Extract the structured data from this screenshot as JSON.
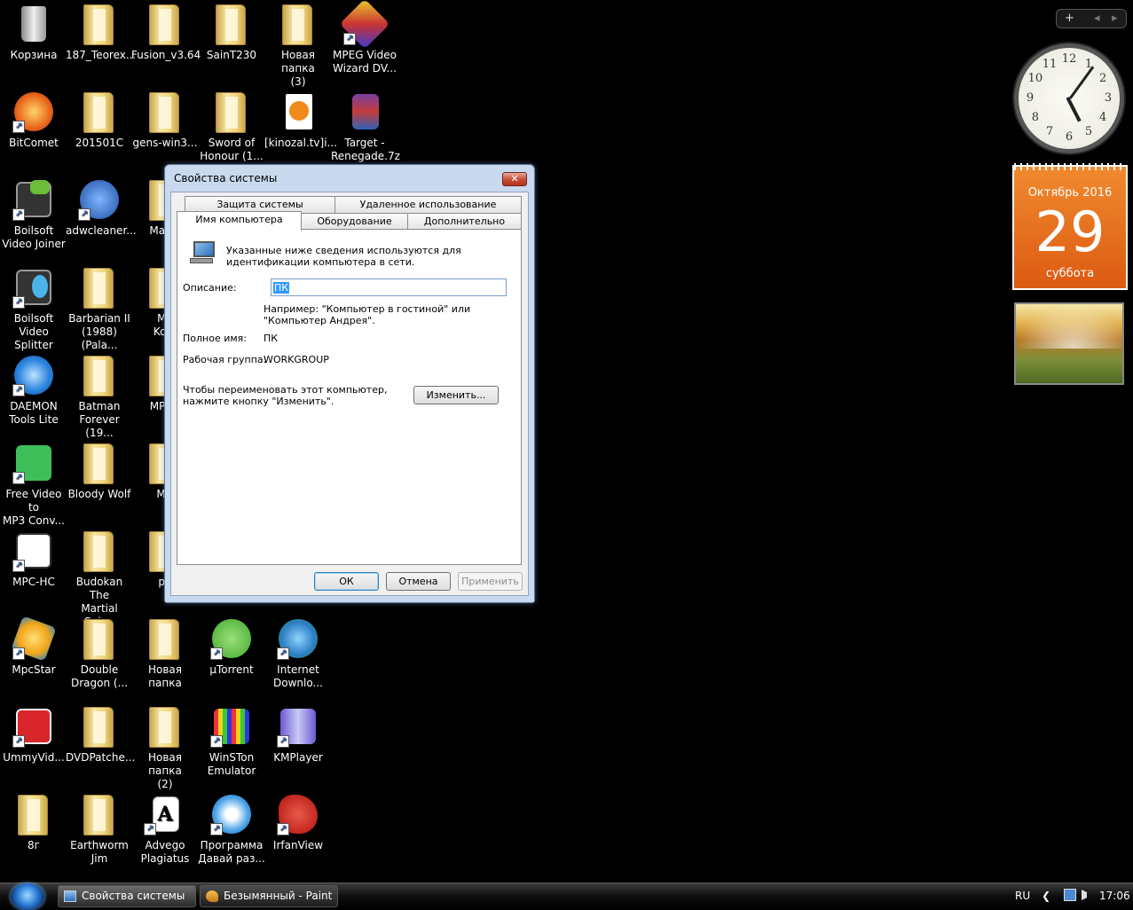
{
  "desktop_icons": [
    {
      "label": "Корзина",
      "icon": "recycle-bin-icon"
    },
    {
      "label": "187_Teorex...",
      "icon": "folder-icon"
    },
    {
      "label": "Fusion_v3.64",
      "icon": "folder-icon"
    },
    {
      "label": "SainT230",
      "icon": "folder-icon"
    },
    {
      "label": "Новая папка\n(3)",
      "icon": "folder-icon"
    },
    {
      "label": "MPEG Video\nWizard DV...",
      "icon": "mpeg-wizard-icon"
    },
    {
      "label": "BitComet",
      "icon": "bitcomet-icon"
    },
    {
      "label": "201501C",
      "icon": "folder-icon"
    },
    {
      "label": "gens-win3...",
      "icon": "folder-icon"
    },
    {
      "label": "Sword of\nHonour (1...",
      "icon": "folder-icon"
    },
    {
      "label": "[kinozal.tv]i...",
      "icon": "torrent-file-icon"
    },
    {
      "label": "Target -\nRenegade.7z",
      "icon": "archive-icon"
    },
    {
      "label": "Boilsoft\nVideo Joiner",
      "icon": "video-joiner-icon"
    },
    {
      "label": "adwcleaner...",
      "icon": "adwcleaner-icon"
    },
    {
      "label": "Magic",
      "icon": "folder-icon"
    },
    {
      "label": "Boilsoft\nVideo Splitter",
      "icon": "video-splitter-icon"
    },
    {
      "label": "Barbarian II\n(1988)(Pala...",
      "icon": "folder-icon"
    },
    {
      "label": "Mo\nKom",
      "icon": "folder-icon"
    },
    {
      "label": "DAEMON\nTools Lite",
      "icon": "daemon-tools-icon"
    },
    {
      "label": "Batman\nForever (19...",
      "icon": "folder-icon"
    },
    {
      "label": "MPEG",
      "icon": "folder-icon"
    },
    {
      "label": "Free Video to\nMP3 Conv...",
      "icon": "video-to-mp3-icon"
    },
    {
      "label": "Bloody Wolf",
      "icon": "folder-icon"
    },
    {
      "label": "MU",
      "icon": "folder-icon"
    },
    {
      "label": "MPC-HC",
      "icon": "mpc-hc-icon"
    },
    {
      "label": "Budokan The\nMartial Spir...",
      "icon": "folder-icon"
    },
    {
      "label": "pb",
      "icon": "folder-icon"
    },
    {
      "label": "MpcStar",
      "icon": "mpcstar-icon"
    },
    {
      "label": "Double\nDragon (...",
      "icon": "folder-icon"
    },
    {
      "label": "Новая папка",
      "icon": "folder-icon"
    },
    {
      "label": "µTorrent",
      "icon": "utorrent-icon"
    },
    {
      "label": "Internet\nDownlo...",
      "icon": "idm-icon"
    },
    {
      "label": "UmmyVid...",
      "icon": "ummy-video-icon"
    },
    {
      "label": "DVDPatche...",
      "icon": "folder-icon"
    },
    {
      "label": "Новая папка\n(2)",
      "icon": "folder-icon"
    },
    {
      "label": "WinSTon\nEmulator",
      "icon": "winston-icon"
    },
    {
      "label": "KMPlayer",
      "icon": "kmplayer-icon"
    },
    {
      "label": "8г",
      "icon": "folder-icon"
    },
    {
      "label": "Earthworm\nJim",
      "icon": "folder-icon"
    },
    {
      "label": "Advego\nPlagiatus",
      "icon": "advego-icon"
    },
    {
      "label": "Программа\nДавай раз...",
      "icon": "ie-icon"
    },
    {
      "label": "IrfanView",
      "icon": "irfanview-icon"
    }
  ],
  "dialog": {
    "title": "Свойства системы",
    "close_glyph": "✕",
    "tabs_row1": [
      "Защита системы",
      "Удаленное использование"
    ],
    "tabs_row2": [
      "Имя компьютера",
      "Оборудование",
      "Дополнительно"
    ],
    "active_tab": "Имя компьютера",
    "intro": "Указанные ниже сведения используются для\nидентификации компьютера в сети.",
    "description_label": "Описание:",
    "description_value": "ПК",
    "example": "Например: \"Компьютер в гостиной\" или\n\"Компьютер Андрея\".",
    "fullname_label": "Полное имя:",
    "fullname_value": "ПК",
    "workgroup_label": "Рабочая группа:",
    "workgroup_value": "WORKGROUP",
    "rename_text": "Чтобы переименовать этот компьютер,\nнажмите кнопку \"Изменить\".",
    "change_button": "Изменить...",
    "ok_button": "ОК",
    "cancel_button": "Отмена",
    "apply_button": "Применить"
  },
  "sidebar": {
    "add_glyph": "+",
    "prev_glyph": "◂",
    "next_glyph": "▸",
    "clock": {
      "hour": 5,
      "minute": 6,
      "numbers": [
        "12",
        "1",
        "2",
        "3",
        "4",
        "5",
        "6",
        "7",
        "8",
        "9",
        "10",
        "11"
      ]
    },
    "calendar": {
      "month_year": "Октябрь 2016",
      "day": "29",
      "weekday": "суббота"
    }
  },
  "taskbar": {
    "items": [
      {
        "label": "Свойства системы",
        "icon": "system-properties-icon",
        "active": true
      },
      {
        "label": "Безымянный - Paint",
        "icon": "paint-icon",
        "active": false
      }
    ],
    "language": "RU",
    "tray_arrow": "❮",
    "time": "17:06"
  },
  "colors": {
    "accent": "#3399ff",
    "calendar": "#e8701e",
    "close_button": "#c74a32"
  }
}
